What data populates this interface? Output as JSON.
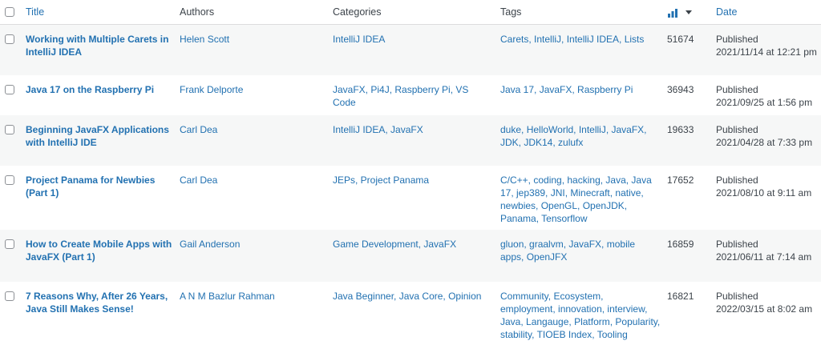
{
  "header": {
    "title": "Title",
    "authors": "Authors",
    "categories": "Categories",
    "tags": "Tags",
    "date": "Date",
    "views_icon": "bar-chart-icon",
    "sort_icon": "sort-desc-icon"
  },
  "rows": [
    {
      "title": "Working with Multiple Carets in IntelliJ IDEA",
      "author": "Helen Scott",
      "categories": "IntelliJ IDEA",
      "tags": "Carets, IntelliJ, IntelliJ IDEA, Lists",
      "views": "51674",
      "status": "Published",
      "date": "2021/11/14 at 12:21 pm"
    },
    {
      "title": "Java 17 on the Raspberry Pi",
      "author": "Frank Delporte",
      "categories": "JavaFX, Pi4J, Raspberry Pi, VS Code",
      "tags": "Java 17, JavaFX, Raspberry Pi",
      "views": "36943",
      "status": "Published",
      "date": "2021/09/25 at 1:56 pm"
    },
    {
      "title": "Beginning JavaFX Applications with IntelliJ IDE",
      "author": "Carl Dea",
      "categories": "IntelliJ IDEA, JavaFX",
      "tags": "duke, HelloWorld, IntelliJ, JavaFX, JDK, JDK14, zulufx",
      "views": "19633",
      "status": "Published",
      "date": "2021/04/28 at 7:33 pm"
    },
    {
      "title": "Project Panama for Newbies (Part 1)",
      "author": "Carl Dea",
      "categories": "JEPs, Project Panama",
      "tags": "C/C++, coding, hacking, Java, Java 17, jep389, JNI, Minecraft, native, newbies, OpenGL, OpenJDK, Panama, Tensorflow",
      "views": "17652",
      "status": "Published",
      "date": "2021/08/10 at 9:11 am"
    },
    {
      "title": "How to Create Mobile Apps with JavaFX (Part 1)",
      "author": "Gail Anderson",
      "categories": "Game Development, JavaFX",
      "tags": "gluon, graalvm, JavaFX, mobile apps, OpenJFX",
      "views": "16859",
      "status": "Published",
      "date": "2021/06/11 at 7:14 am"
    },
    {
      "title": "7 Reasons Why, After 26 Years, Java Still Makes Sense!",
      "author": "A N M Bazlur Rahman",
      "categories": "Java Beginner, Java Core, Opinion",
      "tags": "Community, Ecosystem, employment, innovation, interview, Java, Langauge, Platform, Popularity, stability, TIOEB Index, Tooling",
      "views": "16821",
      "status": "Published",
      "date": "2022/03/15 at 8:02 am"
    }
  ]
}
